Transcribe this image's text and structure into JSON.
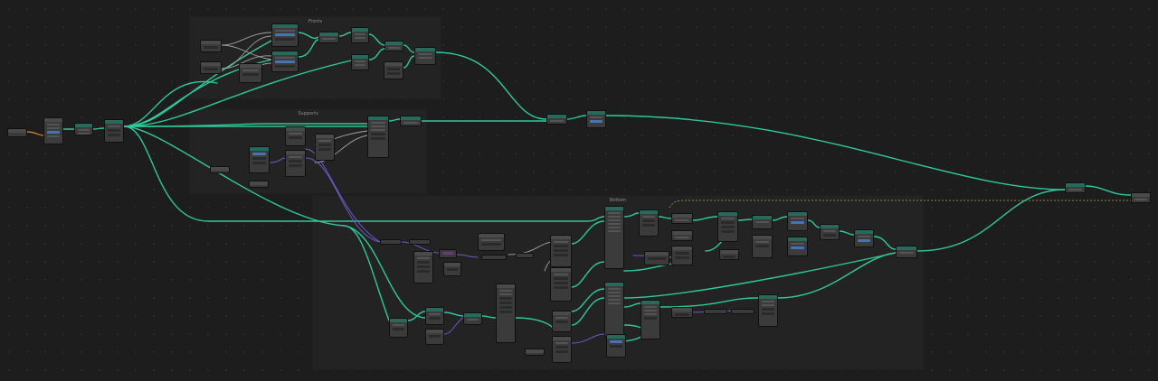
{
  "editor": {
    "frames": [
      {
        "id": "frame-1",
        "label": "Fronts"
      },
      {
        "id": "frame-2",
        "label": "Supports"
      },
      {
        "id": "frame-3",
        "label": "Bottom"
      }
    ],
    "colors": {
      "background": "#1d1d1d",
      "frame_bg": "#232323",
      "node_bg": "#3b3b3b",
      "node_header_geometry": "#27695a",
      "wire_geometry": "#2fc89a",
      "wire_vector": "#6a5ac8",
      "wire_float": "#a1a1a1",
      "wire_int": "#e08a3a",
      "wire_dashed": "#b7b04a"
    }
  }
}
